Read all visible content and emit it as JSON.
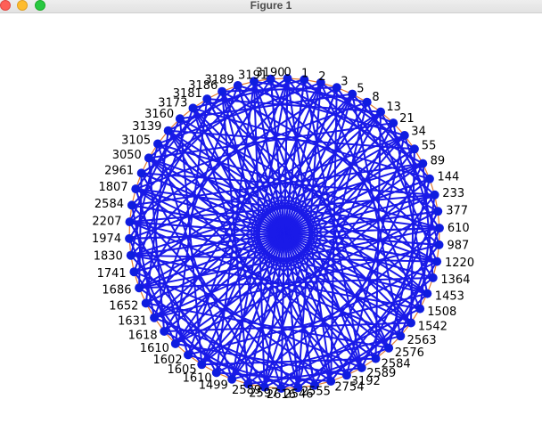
{
  "window": {
    "title": "Figure 1"
  },
  "graph": {
    "node_color": "#0f1ce0",
    "edge_color": "#1a1ae8",
    "nodes": [
      "0",
      "1",
      "2",
      "3",
      "5",
      "8",
      "13",
      "21",
      "34",
      "55",
      "89",
      "144",
      "233",
      "377",
      "610",
      "987",
      "1220",
      "1364",
      "1453",
      "1508",
      "1542",
      "2563",
      "2576",
      "2584",
      "2589",
      "3192",
      "2754",
      "2555",
      "2546",
      "2616",
      "2597",
      "2589",
      "1499",
      "1610",
      "1605",
      "1602",
      "1610",
      "1618",
      "1631",
      "1652",
      "1686",
      "1741",
      "1830",
      "1974",
      "2207",
      "2584",
      "1807",
      "2961",
      "3050",
      "3105",
      "3139",
      "3160",
      "3173",
      "3181",
      "3186",
      "3189",
      "3191",
      "3190"
    ],
    "extra_edge_color": "#e07a35"
  }
}
